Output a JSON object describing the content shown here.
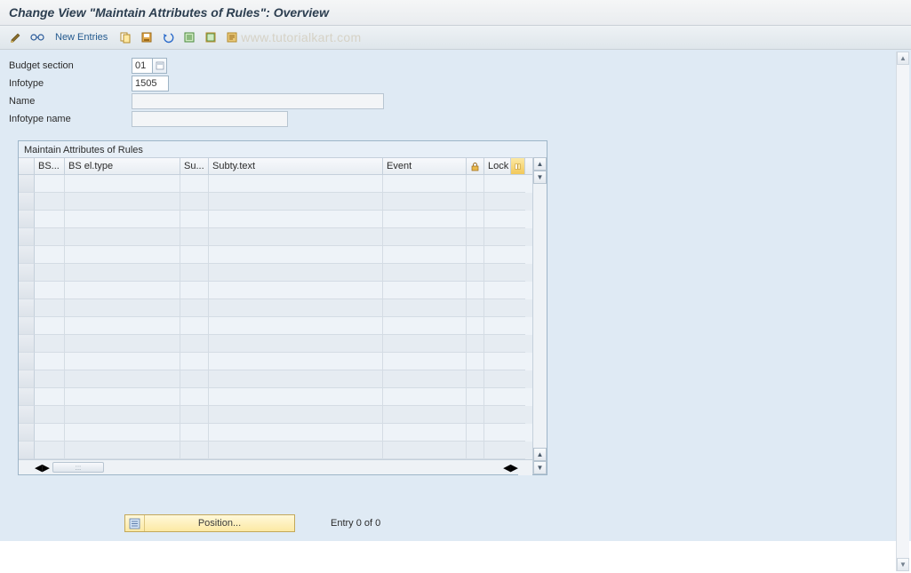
{
  "title": "Change View \"Maintain Attributes of Rules\": Overview",
  "toolbar": {
    "new_entries": "New Entries"
  },
  "watermark": "www.tutorialkart.com",
  "form": {
    "budget_section_label": "Budget section",
    "budget_section_value": "01",
    "infotype_label": "Infotype",
    "infotype_value": "1505",
    "name_label": "Name",
    "name_value": "",
    "infotype_name_label": "Infotype name",
    "infotype_name_value": ""
  },
  "table": {
    "title": "Maintain Attributes of Rules",
    "columns": {
      "bs": "BS...",
      "bs_el_type": "BS el.type",
      "su": "Su...",
      "subty_text": "Subty.text",
      "event": "Event",
      "lock": "Lock"
    }
  },
  "footer": {
    "position_label": "Position...",
    "entry_text": "Entry 0 of 0"
  }
}
